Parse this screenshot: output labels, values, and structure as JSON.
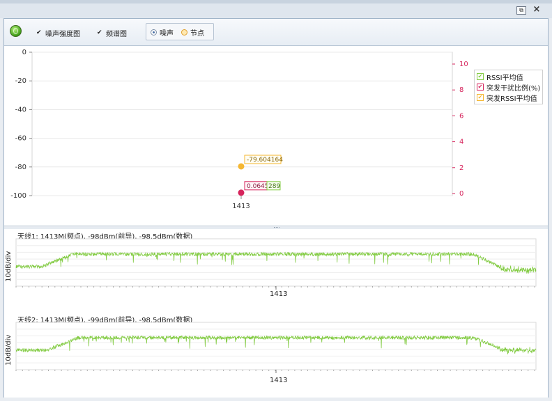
{
  "window": {
    "restore_icon": "restore-icon",
    "close_icon": "close-icon",
    "close_glyph": "×"
  },
  "toolbar": {
    "status_icon": "status-led-icon",
    "checkboxes": [
      {
        "label": "噪声强度图",
        "checked": true
      },
      {
        "label": "频谱图",
        "checked": true
      }
    ],
    "radios": [
      {
        "label": "噪声",
        "selected": true
      },
      {
        "label": "节点",
        "selected": false,
        "hovered": true
      }
    ]
  },
  "colors": {
    "rssi": "#f5b731",
    "burst": "#d6245c",
    "spectrum": "#84cc45",
    "grid": "#e8e8e8",
    "right_axis": "#d6245c"
  },
  "chart_data": [
    {
      "type": "scatter",
      "categories": [
        "1413"
      ],
      "left_axis": {
        "ylim": [
          -100,
          0
        ],
        "ticks": [
          0,
          -20,
          -40,
          -60,
          -80,
          -100
        ]
      },
      "right_axis": {
        "ylim": [
          -1,
          10
        ],
        "ticks": [
          10,
          8,
          6,
          4,
          2,
          0
        ]
      },
      "series": [
        {
          "name": "RSSI平均值",
          "color": "#84cc45",
          "values": [],
          "axis": "left"
        },
        {
          "name": "突发干扰比例(%)",
          "color": "#d6245c",
          "values": [
            0.0645
          ],
          "axis": "right",
          "label": "0.0645"
        },
        {
          "name": "突发RSSI平均值",
          "color": "#f5b731",
          "values": [
            -79.604164
          ],
          "axis": "left",
          "label": "-79.604164"
        }
      ],
      "extra_labels": [
        {
          "text": "289",
          "color": "#84cc45"
        }
      ],
      "legend": "top-right",
      "grid": true
    },
    {
      "type": "line",
      "title": "天线1: 1413M(频点), -98dBm(前导), -98.5dBm(数据)",
      "ylabel": "10dB/div",
      "xlabel": "1413",
      "shape": {
        "floor_left": -4,
        "plateau": 0,
        "floor_right": -5,
        "rise": 0.08,
        "fall": 0.9
      }
    },
    {
      "type": "line",
      "title": "天线2: 1413M(频点), -99dBm(前导), -98.5dBm(数据)",
      "ylabel": "10dB/div",
      "xlabel": "1413",
      "shape": {
        "floor_left": -4,
        "plateau": 0,
        "floor_right": -4,
        "rise": 0.09,
        "fall": 0.9
      }
    }
  ]
}
